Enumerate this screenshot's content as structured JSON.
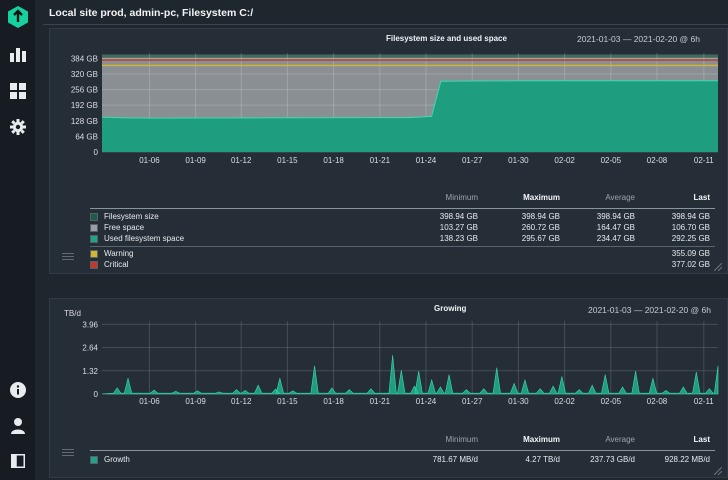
{
  "page": {
    "title": "Local site prod, admin-pc, Filesystem C:/"
  },
  "sidebar": {
    "items": [
      {
        "name": "logo",
        "icon": "checkmk-logo-icon"
      },
      {
        "name": "monitor",
        "icon": "bar-chart-icon"
      },
      {
        "name": "setup",
        "icon": "grid-icon"
      },
      {
        "name": "customize",
        "icon": "gear-icon"
      },
      {
        "name": "help",
        "icon": "info-icon"
      },
      {
        "name": "user",
        "icon": "user-icon"
      },
      {
        "name": "toggle",
        "icon": "sidebar-toggle-icon"
      }
    ]
  },
  "legend_columns": {
    "minimum": "Minimum",
    "maximum": "Maximum",
    "average": "Average",
    "last": "Last"
  },
  "graph1": {
    "title": "Filesystem size and used space",
    "range": "2021-01-03 — 2021-02-20 @ 6h",
    "chart_data": {
      "type": "area",
      "yticks": [
        "384 GB",
        "320 GB",
        "256 GB",
        "192 GB",
        "128 GB",
        "64 GB",
        "0"
      ],
      "ylim": [
        0,
        398.94
      ],
      "xticks": [
        "01-06",
        "01-09",
        "01-12",
        "01-15",
        "01-18",
        "01-21",
        "01-24",
        "01-27",
        "01-30",
        "02-02",
        "02-05",
        "02-08",
        "02-11"
      ],
      "series": [
        {
          "name": "Filesystem size",
          "color": "#1f5b49",
          "values": [
            398.94,
            398.94
          ]
        },
        {
          "name": "Free space",
          "color": "#8a8f93"
        },
        {
          "name": "Used filesystem space",
          "color": "#1e9e7e",
          "steps": [
            {
              "x": 0,
              "v": 143
            },
            {
              "x": 0.04,
              "v": 140
            },
            {
              "x": 0.08,
              "v": 139
            },
            {
              "x": 0.5,
              "v": 141
            },
            {
              "x": 0.535,
              "v": 146
            },
            {
              "x": 0.55,
              "v": 290
            },
            {
              "x": 0.6,
              "v": 291
            },
            {
              "x": 0.7,
              "v": 292
            },
            {
              "x": 1.0,
              "v": 292.25
            }
          ]
        }
      ],
      "thresholds": [
        {
          "name": "Warning",
          "value": 355.09,
          "color": "#d4b62c"
        },
        {
          "name": "Critical",
          "value": 377.02,
          "color": "#c0392b"
        }
      ]
    },
    "legend": [
      {
        "name": "Filesystem size",
        "color": "#1f5b49",
        "min": "398.94 GB",
        "max": "398.94 GB",
        "avg": "398.94 GB",
        "last": "398.94 GB"
      },
      {
        "name": "Free space",
        "color": "#9a9ea2",
        "min": "103.27 GB",
        "max": "260.72 GB",
        "avg": "164.47 GB",
        "last": "106.70 GB"
      },
      {
        "name": "Used filesystem space",
        "color": "#21a485",
        "min": "138.23 GB",
        "max": "295.67 GB",
        "avg": "234.47 GB",
        "last": "292.25 GB"
      }
    ],
    "thresholds_legend": [
      {
        "name": "Warning",
        "color": "#d4b62c",
        "last": "355.09 GB"
      },
      {
        "name": "Critical",
        "color": "#c0392b",
        "last": "377.02 GB"
      }
    ]
  },
  "graph2": {
    "title": "Growing",
    "range": "2021-01-03 — 2021-02-20 @ 6h",
    "yunit": "TB/d",
    "chart_data": {
      "type": "area",
      "yticks": [
        "3.96",
        "2.64",
        "1.32",
        "0"
      ],
      "ylim": [
        0,
        4.27
      ],
      "xticks": [
        "01-06",
        "01-09",
        "01-12",
        "01-15",
        "01-18",
        "01-21",
        "01-24",
        "01-27",
        "01-30",
        "02-02",
        "02-05",
        "02-08",
        "02-11"
      ],
      "series": [
        {
          "name": "Growth",
          "color": "#1e9e7e",
          "peaks": [
            {
              "x": 0.035,
              "v": 0.35
            },
            {
              "x": 0.06,
              "v": 0.9
            },
            {
              "x": 0.12,
              "v": 0.22
            },
            {
              "x": 0.17,
              "v": 0.15
            },
            {
              "x": 0.22,
              "v": 0.18
            },
            {
              "x": 0.27,
              "v": 0.12
            },
            {
              "x": 0.31,
              "v": 0.25
            },
            {
              "x": 0.33,
              "v": 0.2
            },
            {
              "x": 0.36,
              "v": 0.5
            },
            {
              "x": 0.4,
              "v": 0.28
            },
            {
              "x": 0.41,
              "v": 0.9
            },
            {
              "x": 0.44,
              "v": 0.18
            },
            {
              "x": 0.49,
              "v": 1.6
            },
            {
              "x": 0.53,
              "v": 0.35
            },
            {
              "x": 0.57,
              "v": 0.25
            },
            {
              "x": 0.62,
              "v": 0.3
            },
            {
              "x": 0.67,
              "v": 2.2
            },
            {
              "x": 0.69,
              "v": 1.35
            },
            {
              "x": 0.72,
              "v": 0.45
            },
            {
              "x": 0.73,
              "v": 1.3
            },
            {
              "x": 0.76,
              "v": 0.8
            },
            {
              "x": 0.78,
              "v": 0.4
            },
            {
              "x": 0.8,
              "v": 1.1
            },
            {
              "x": 0.84,
              "v": 0.25
            },
            {
              "x": 0.88,
              "v": 0.3
            },
            {
              "x": 0.91,
              "v": 1.5
            },
            {
              "x": 0.95,
              "v": 0.6
            },
            {
              "x": 0.975,
              "v": 0.8
            },
            {
              "x": 1.01,
              "v": 0.3
            },
            {
              "x": 1.04,
              "v": 0.45
            },
            {
              "x": 1.06,
              "v": 1.0
            },
            {
              "x": 1.1,
              "v": 0.25
            },
            {
              "x": 1.13,
              "v": 0.5
            },
            {
              "x": 1.16,
              "v": 1.1
            },
            {
              "x": 1.2,
              "v": 0.4
            },
            {
              "x": 1.23,
              "v": 1.3
            },
            {
              "x": 1.27,
              "v": 0.9
            },
            {
              "x": 1.3,
              "v": 0.2
            },
            {
              "x": 1.34,
              "v": 0.4
            },
            {
              "x": 1.37,
              "v": 1.25
            },
            {
              "x": 1.4,
              "v": 0.3
            },
            {
              "x": 1.42,
              "v": 1.6
            }
          ]
        }
      ]
    },
    "legend": [
      {
        "name": "Growth",
        "color": "#21a485",
        "min": "781.67 MB/d",
        "max": "4.27 TB/d",
        "avg": "237.73 GB/d",
        "last": "928.22 MB/d"
      }
    ]
  }
}
